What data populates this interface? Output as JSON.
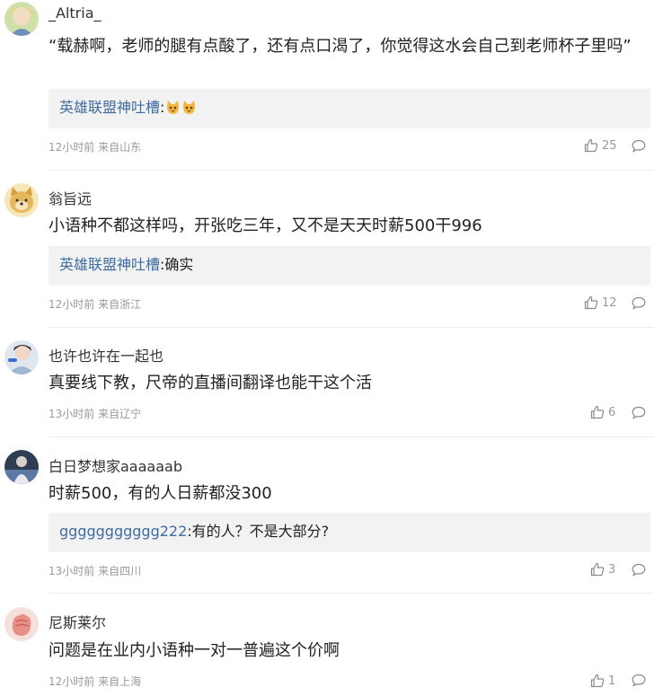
{
  "comments": [
    {
      "username": "_Altria_",
      "text": "“载赫啊，老师的腿有点酸了，还有点口渴了，你觉得这水会自己到老师杯子里吗”",
      "reply": {
        "user": "英雄联盟神吐槽",
        "sep": ":",
        "text": ""
      },
      "reply_emoji": [
        "cat-emoji",
        "cat-emoji"
      ],
      "meta": "12小时前 来自山东",
      "likes": "25"
    },
    {
      "username": "翁旨远",
      "text": "小语种不都这样吗，开张吃三年，又不是天天时薪500干996",
      "reply": {
        "user": "英雄联盟神吐槽",
        "sep": ":",
        "text": "确实"
      },
      "meta": "12小时前 来自浙江",
      "likes": "12"
    },
    {
      "username": "也许也许在一起也",
      "text": "真要线下教，尺帝的直播间翻译也能干这个活",
      "meta": "13小时前 来自辽宁",
      "likes": "6"
    },
    {
      "username": "白日梦想家aaaaaab",
      "text": "时薪500，有的人日薪都没300",
      "reply": {
        "user": "ggggggggggg222",
        "sep": ":",
        "text": "有的人？不是大部分?"
      },
      "meta": "13小时前 来自四川",
      "likes": "3"
    },
    {
      "username": "尼斯莱尔",
      "text": "问题是在业内小语种一对一普遍这个价啊",
      "meta": "12小时前 来自上海",
      "likes": "1"
    }
  ],
  "icons": {
    "like": "thumbs-up-icon",
    "reply": "comment-bubble-icon"
  }
}
